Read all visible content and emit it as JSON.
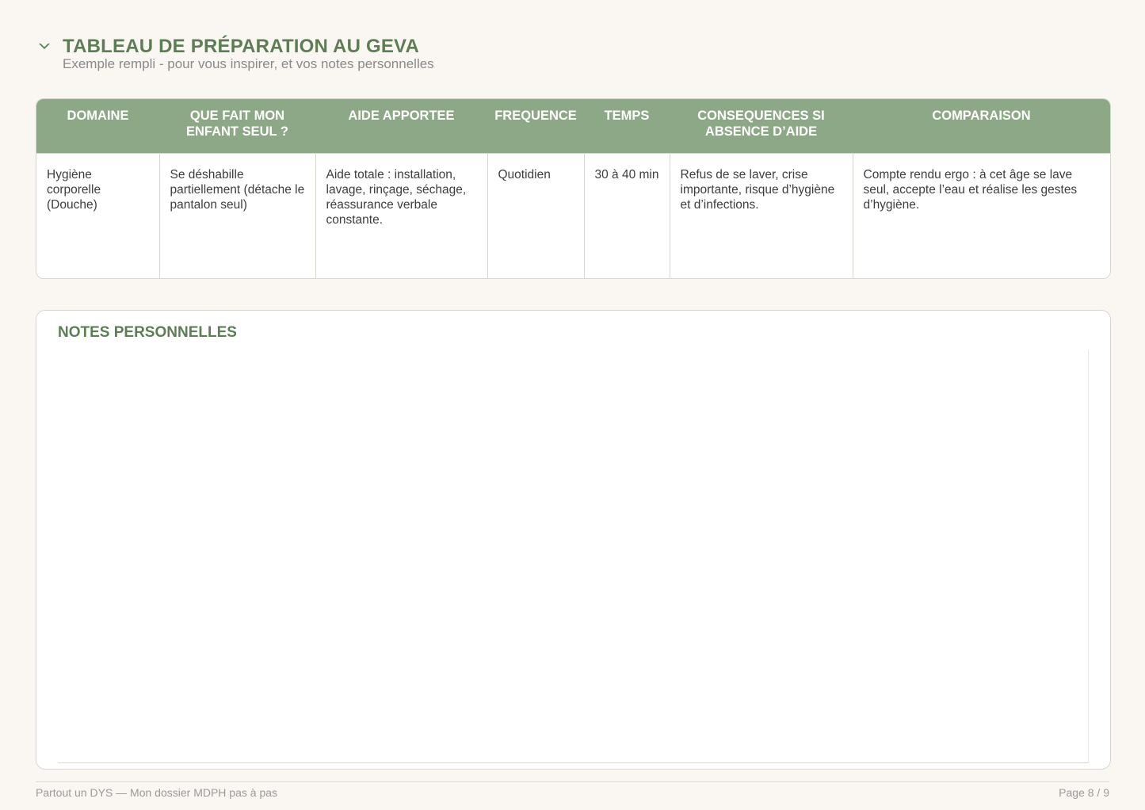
{
  "header": {
    "icon": "chevron-down-icon",
    "title": "TABLEAU DE PRÉPARATION AU GEVA",
    "subtitle": "Exemple rempli - pour vous inspirer, et vos notes personnelles"
  },
  "table": {
    "columns": [
      "DOMAINE",
      "QUE FAIT MON ENFANT SEUL ?",
      "AIDE APPORTEE",
      "FREQUENCE",
      "TEMPS",
      "CONSEQUENCES SI ABSENCE D’AIDE",
      "COMPARAISON"
    ],
    "rows": [
      [
        "Hygiène corporelle (Douche)",
        "Se déshabille partiellement (détache le pantalon seul)",
        "Aide totale : installation, lavage, rinçage, séchage, réassurance verbale constante.",
        "Quotidien",
        "30 à 40 min",
        "Refus de se laver, crise importante, risque d’hygiène et d’infections.",
        "Compte rendu ergo : à cet âge se lave seul, accepte l’eau et réalise les gestes d’hygiène."
      ]
    ]
  },
  "notes": {
    "title": "NOTES PERSONNELLES"
  },
  "footer": {
    "left": "Partout un DYS — Mon dossier MDPH pas à pas",
    "right": "Page 8 / 9"
  },
  "colors": {
    "accent": "#5d7e54",
    "header_bg": "#8da886",
    "page_bg": "#faf7f2"
  }
}
